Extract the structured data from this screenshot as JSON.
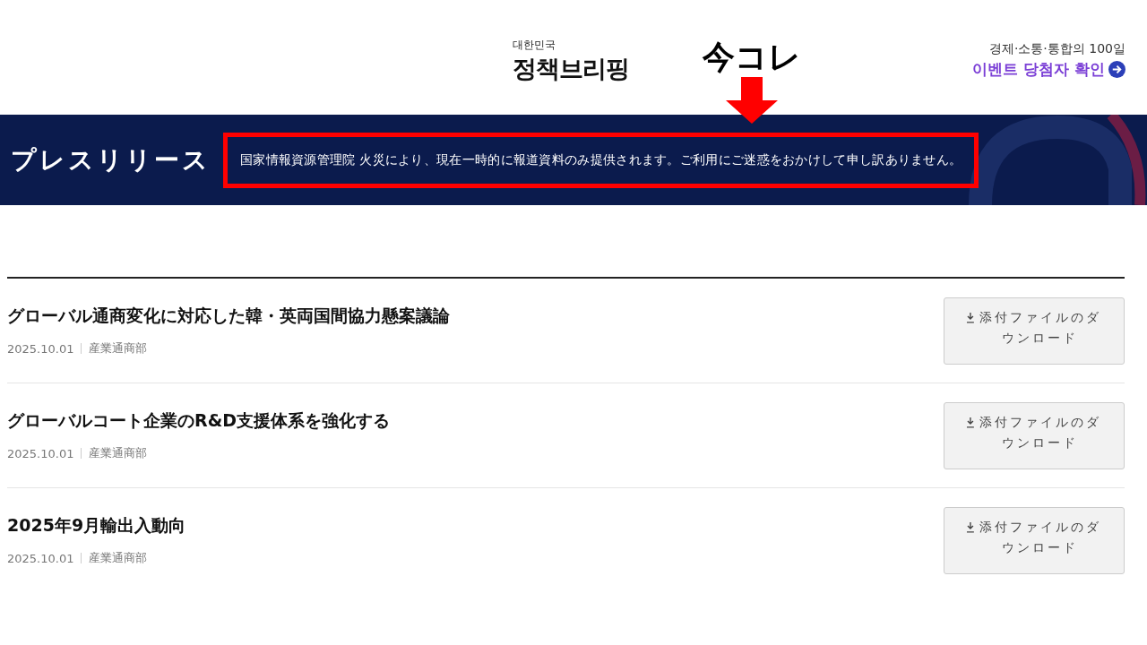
{
  "header": {
    "logo_caption": "대한민국",
    "logo_title": "정책브리핑",
    "promo_caption": "경제·소통·통합의 100일",
    "promo_link": "이벤트 당첨자 확인"
  },
  "banner": {
    "title": "プレスリリース",
    "notice": "国家情報資源管理院 火災により、現在一時的に報道資料のみ提供されます。ご利用にご迷惑をおかけして申し訳ありません。"
  },
  "annotation": {
    "label": "今コレ"
  },
  "releases": [
    {
      "title": "グローバル通商変化に対応した韓・英両国間協力懸案議論",
      "date": "2025.10.01",
      "department": "産業通商部",
      "button": "添付ファイルのダウンロード"
    },
    {
      "title": "グローバルコート企業のR&D支援体系を強化する",
      "date": "2025.10.01",
      "department": "産業通商部",
      "button": "添付ファイルのダウンロード"
    },
    {
      "title": "2025年9月輸出入動向",
      "date": "2025.10.01",
      "department": "産業通商部",
      "button": "添付ファイルのダウンロード"
    }
  ]
}
